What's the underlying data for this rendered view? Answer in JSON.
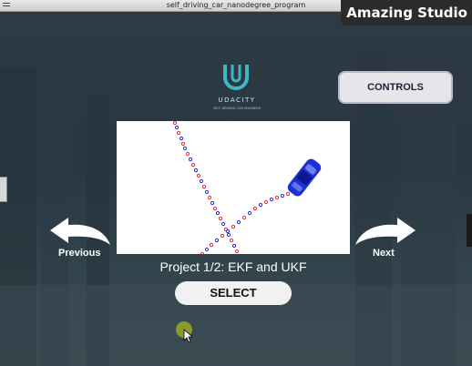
{
  "window": {
    "title": "self_driving_car_nanodegree_program"
  },
  "brand": {
    "label": "Amazing Studio"
  },
  "logo": {
    "wordmark": "UDACITY",
    "tagline": "SELF-DRIVING CAR ENGINEER"
  },
  "controls": {
    "label": "CONTROLS"
  },
  "navigation": {
    "previous_label": "Previous",
    "next_label": "Next"
  },
  "project": {
    "title": "Project 1/2: EKF and UKF"
  },
  "select": {
    "label": "SELECT"
  },
  "colors": {
    "accent": "#3fb7c9",
    "car": "#1e2fd6",
    "marker_red": "#e0303a",
    "marker_blue": "#2a2ad0"
  }
}
